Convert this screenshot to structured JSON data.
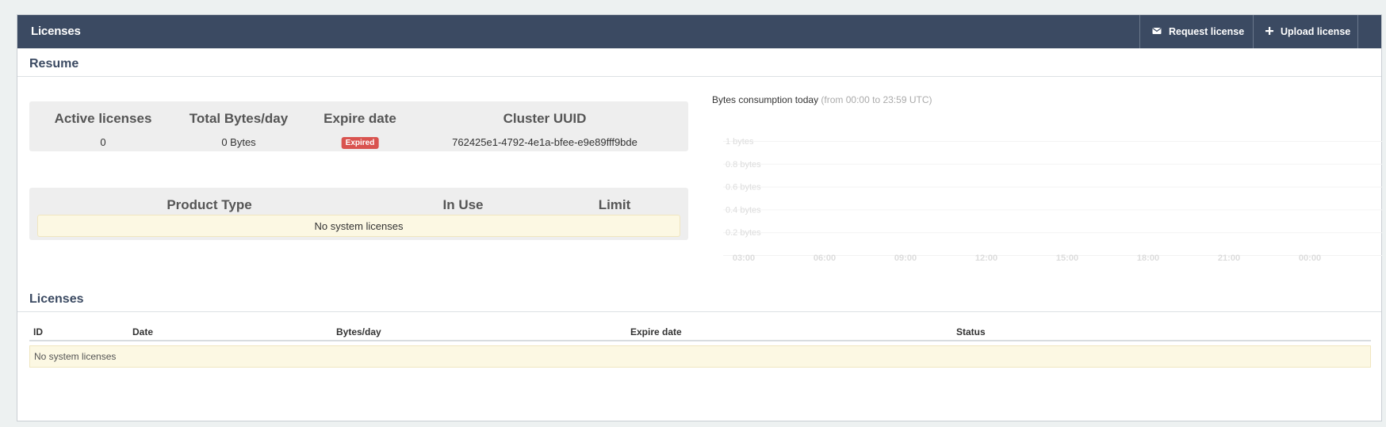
{
  "header": {
    "title": "Licenses",
    "request_label": "Request license",
    "upload_label": "Upload license",
    "request_icon": "envelope-icon",
    "upload_icon": "plus-icon"
  },
  "resume": {
    "title": "Resume",
    "stats": {
      "active_licenses_label": "Active licenses",
      "active_licenses_value": "0",
      "total_bytes_label": "Total Bytes/day",
      "total_bytes_value": "0 Bytes",
      "expire_label": "Expire date",
      "expire_badge": "Expired",
      "cluster_label": "Cluster UUID",
      "cluster_value": "762425e1-4792-4e1a-bfee-e9e89fff9bde"
    },
    "products": {
      "columns": [
        "Product Type",
        "In Use",
        "Limit"
      ],
      "empty": "No system licenses"
    }
  },
  "chart": {
    "title": "Bytes consumption today",
    "subtitle": "(from 00:00 to 23:59 UTC)"
  },
  "chart_data": {
    "type": "line",
    "title": "Bytes consumption today",
    "subtitle": "(from 00:00 to 23:59 UTC)",
    "x_ticks": [
      "03:00",
      "06:00",
      "09:00",
      "12:00",
      "15:00",
      "18:00",
      "21:00",
      "00:00"
    ],
    "y_ticks": [
      "1 bytes",
      "0.8 bytes",
      "0.6 bytes",
      "0.4 bytes",
      "0.2 bytes"
    ],
    "ylim": [
      0,
      1
    ],
    "series": [],
    "grid": true
  },
  "licenses": {
    "title": "Licenses",
    "columns": [
      "ID",
      "Date",
      "Bytes/day",
      "Expire date",
      "Status"
    ],
    "empty": "No system licenses"
  },
  "colors": {
    "header_bg": "#3b4a62",
    "expired_badge": "#d9534f",
    "empty_row_bg": "#fcf8e3"
  }
}
